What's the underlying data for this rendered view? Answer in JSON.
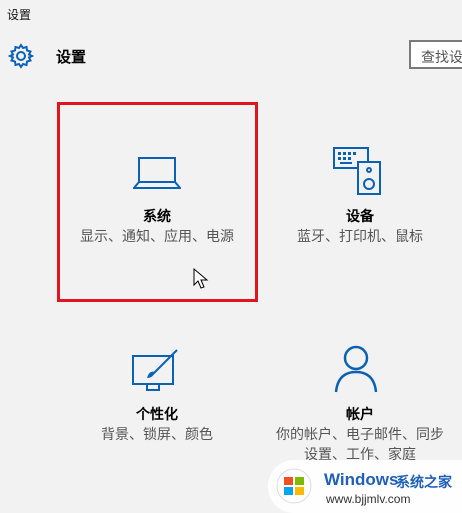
{
  "window": {
    "title": "设置"
  },
  "header": {
    "title": "设置",
    "search_placeholder": "查找设置"
  },
  "tiles": [
    {
      "title": "系统",
      "desc": "显示、通知、应用、电源",
      "icon": "laptop-icon"
    },
    {
      "title": "设备",
      "desc": "蓝牙、打印机、鼠标",
      "icon": "devices-icon"
    },
    {
      "title": "个性化",
      "desc": "背景、锁屏、颜色",
      "icon": "personalization-icon"
    },
    {
      "title": "帐户",
      "desc": "你的帐户、电子邮件、同步设置、工作、家庭",
      "icon": "account-icon"
    }
  ],
  "colors": {
    "accent": "#0b62b5",
    "highlight": "#e0151d"
  },
  "watermark": {
    "brand": "Windows",
    "brand_cn": "系统之家",
    "url": "www.bjjmlv.com"
  }
}
